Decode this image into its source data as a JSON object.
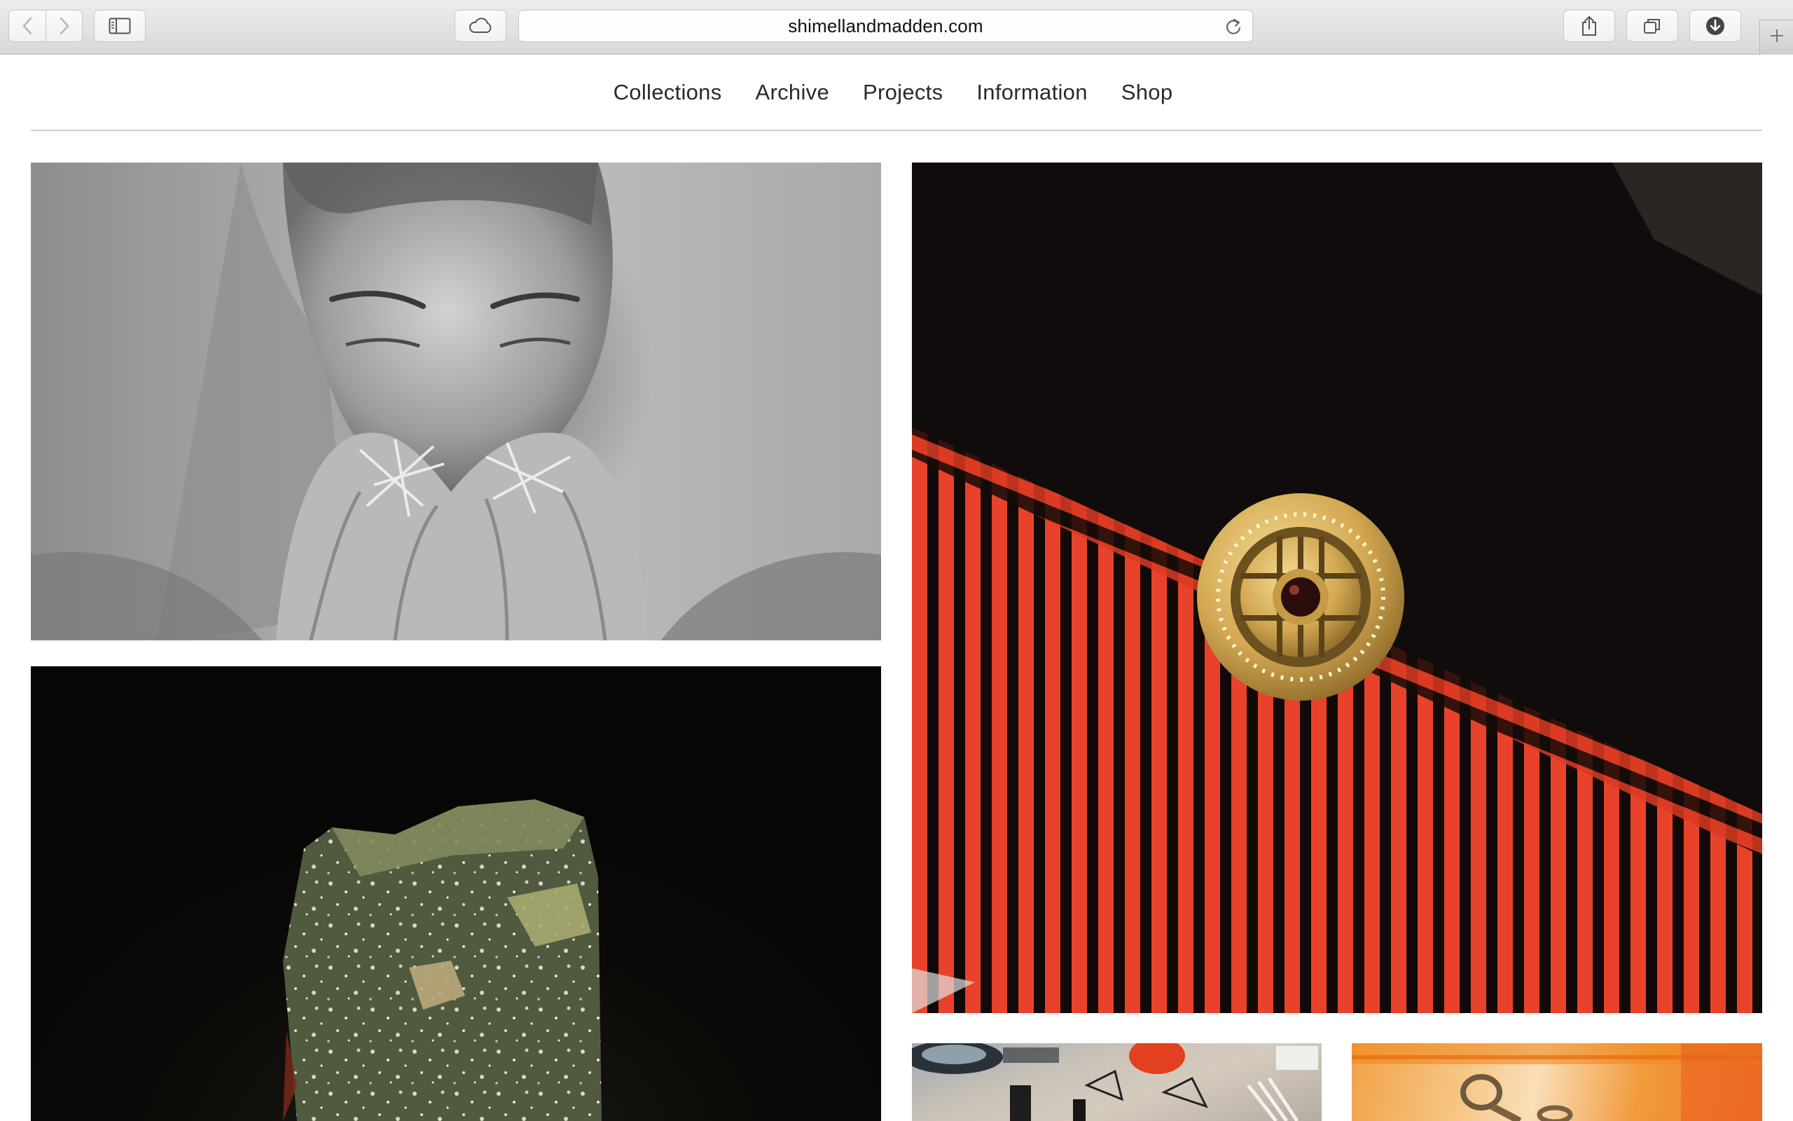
{
  "browser": {
    "url": "shimellandmadden.com",
    "colors": {
      "chrome": "#dfdfdf",
      "url_text": "#111111"
    },
    "icons": [
      "back-icon",
      "forward-icon",
      "sidebar-icon",
      "icloud-tabs-icon",
      "reload-icon",
      "share-icon",
      "tabs-overview-icon",
      "downloads-icon",
      "new-tab-icon"
    ]
  },
  "site": {
    "nav": [
      {
        "label": "Collections"
      },
      {
        "label": "Archive"
      },
      {
        "label": "Projects"
      },
      {
        "label": "Information"
      },
      {
        "label": "Shop"
      }
    ]
  },
  "gallery": {
    "tiles": [
      {
        "subject": "black-and-white portrait of woman wearing star rings"
      },
      {
        "subject": "gold circular ring with garnet on red striped block"
      },
      {
        "subject": "rough green stone on black background"
      },
      {
        "subject": "jewellery workbench with tools"
      },
      {
        "subject": "orange-toned ring close-up"
      }
    ]
  }
}
